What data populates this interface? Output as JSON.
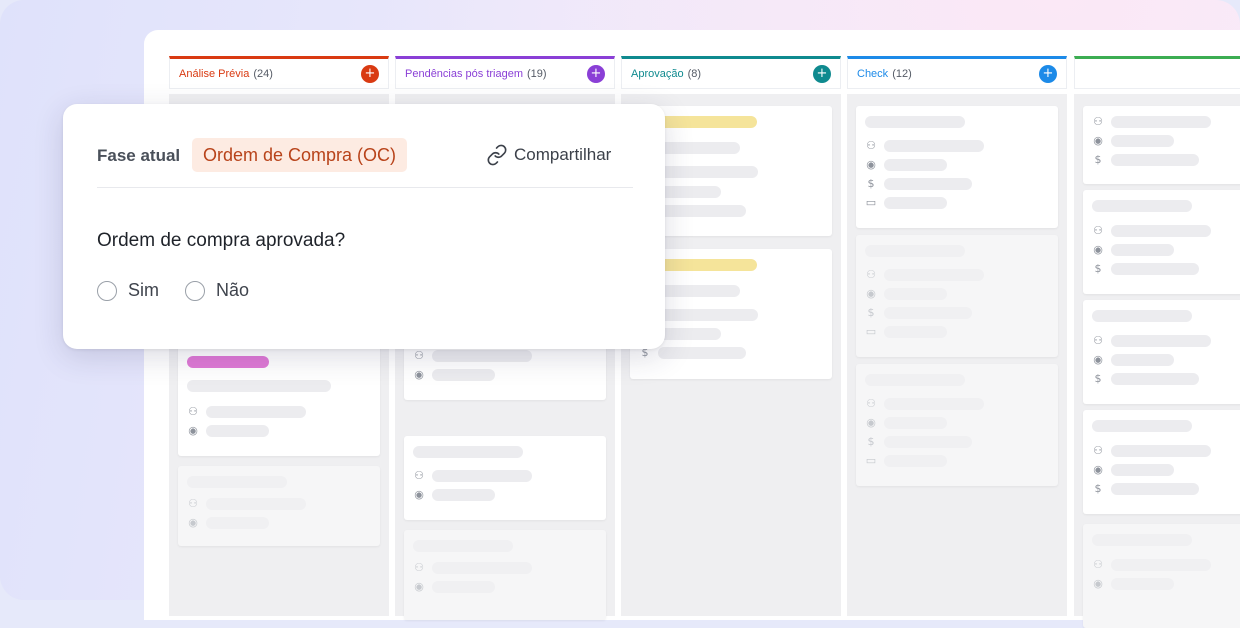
{
  "columns": [
    {
      "title": "Análise Prévia",
      "count": "(24)",
      "color": "#d93a12"
    },
    {
      "title": "Pendências pós triagem",
      "count": "(19)",
      "color": "#8a3fd6"
    },
    {
      "title": "Aprovação",
      "count": "(8)",
      "color": "#0f8a8f"
    },
    {
      "title": "Check",
      "count": "(12)",
      "color": "#1c8ae8"
    },
    {
      "title": "",
      "count": "",
      "color": "#3cad52"
    }
  ],
  "add_symbol": "+",
  "modal": {
    "phase_label": "Fase atual",
    "phase_value": "Ordem de Compra (OC)",
    "share_label": "Compartilhar",
    "question": "Ordem de compra aprovada?",
    "options": [
      "Sim",
      "Não"
    ]
  },
  "colors": {
    "tag_pink": "#e07ad6",
    "tag_yellow": "#f5e49a",
    "badge_bg": "#fdebe2",
    "badge_text": "#b8431a"
  },
  "icons": [
    "user-icon",
    "target-icon",
    "dollar-icon",
    "calendar-icon",
    "link-icon",
    "plus-icon"
  ]
}
